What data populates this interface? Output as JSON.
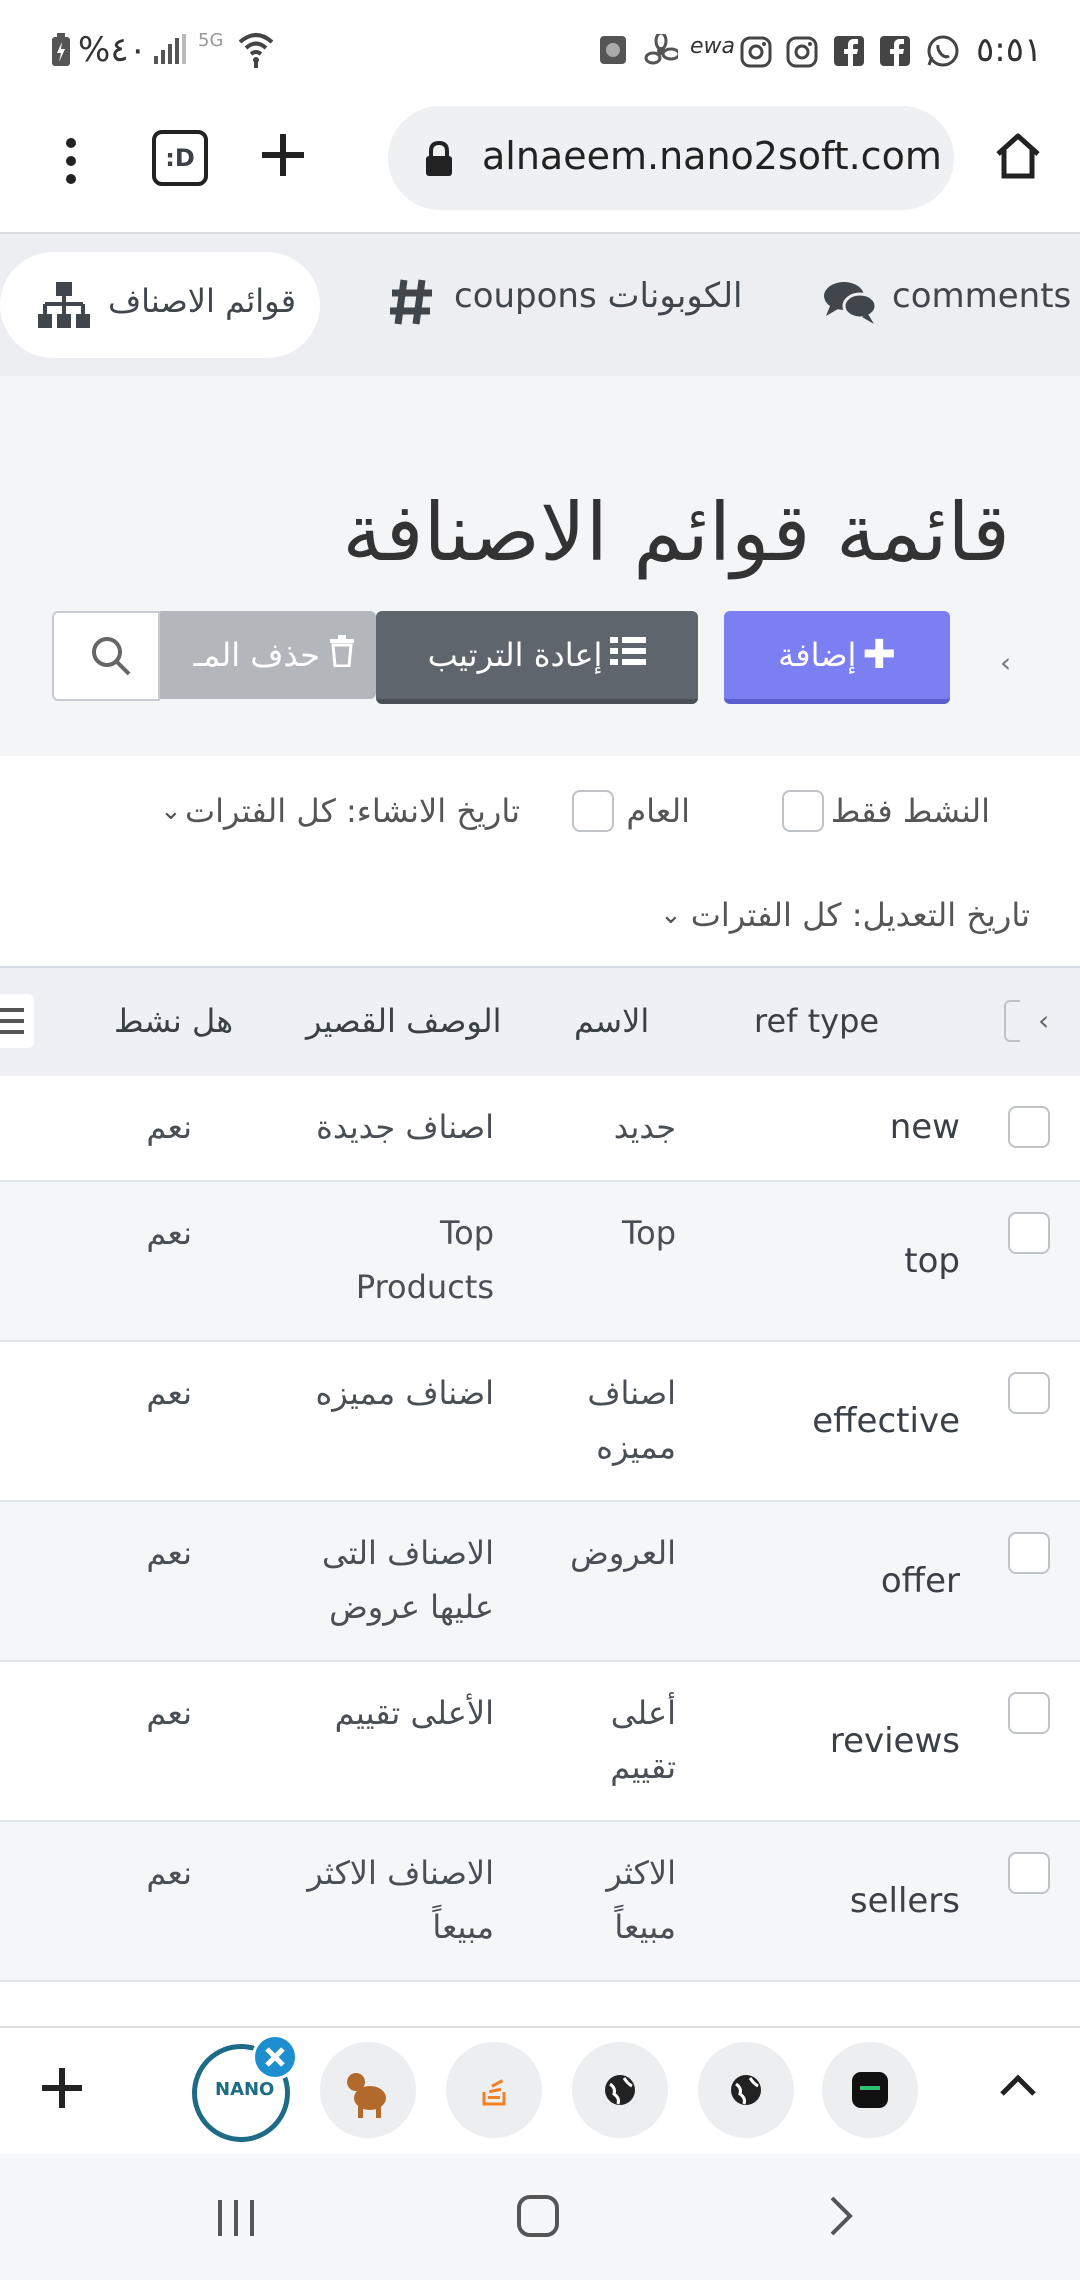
{
  "status_bar": {
    "time": "٥:٥١",
    "battery": "%٤٠"
  },
  "browser": {
    "url": "alnaeem.nano2soft.com",
    "tab_count_label": ":D"
  },
  "nav": {
    "items": [
      {
        "label": "قوائم الاصناف",
        "active": true,
        "icon": "sitemap-icon"
      },
      {
        "label": "coupons الكوبونات",
        "active": false,
        "icon": "hashtag-icon"
      },
      {
        "label": "comments",
        "active": false,
        "icon": "comments-icon"
      }
    ]
  },
  "page": {
    "title": "قائمة قوائم الاصنافة",
    "buttons": {
      "add": "إضافة",
      "reorder": "إعادة الترتيب",
      "delete": "حذف المـ"
    }
  },
  "filters": {
    "active_only": "النشط فقط",
    "public": "العام",
    "created_date": "تاريخ الانشاء: كل الفترات",
    "modified_date": "تاريخ التعديل: كل الفترات"
  },
  "table": {
    "columns": [
      "ref type",
      "الاسم",
      "الوصف القصير",
      "هل نشط"
    ],
    "rows": [
      {
        "ref": "new",
        "name": [
          "جديد"
        ],
        "desc": [
          "اصناف جديدة"
        ],
        "active": "نعم"
      },
      {
        "ref": "top",
        "name": [
          "Top"
        ],
        "desc": [
          "Top",
          "Products"
        ],
        "active": "نعم"
      },
      {
        "ref": "effective",
        "name": [
          "اصناف",
          "مميزه"
        ],
        "desc": [
          "اضناف مميزه"
        ],
        "active": "نعم"
      },
      {
        "ref": "offer",
        "name": [
          "العروض"
        ],
        "desc": [
          "الاصناف التى",
          "عليها عروض"
        ],
        "active": "نعم"
      },
      {
        "ref": "reviews",
        "name": [
          "أعلى",
          "تقييم"
        ],
        "desc": [
          "الأعلى تقييم"
        ],
        "active": "نعم"
      },
      {
        "ref": "sellers",
        "name": [
          "الاكثر",
          "مبيعاً"
        ],
        "desc": [
          "الاصناف الاكثر",
          "مبيعاً"
        ],
        "active": "نعم"
      }
    ]
  },
  "tabs": {
    "active_logo": "NANO"
  },
  "colors": {
    "add_button": "#7b7ff2",
    "reorder_button": "#5f656d",
    "delete_button": "#b3b6ba",
    "active_tab_ring": "#1d6b84",
    "close_badge": "#1d8fcf"
  }
}
